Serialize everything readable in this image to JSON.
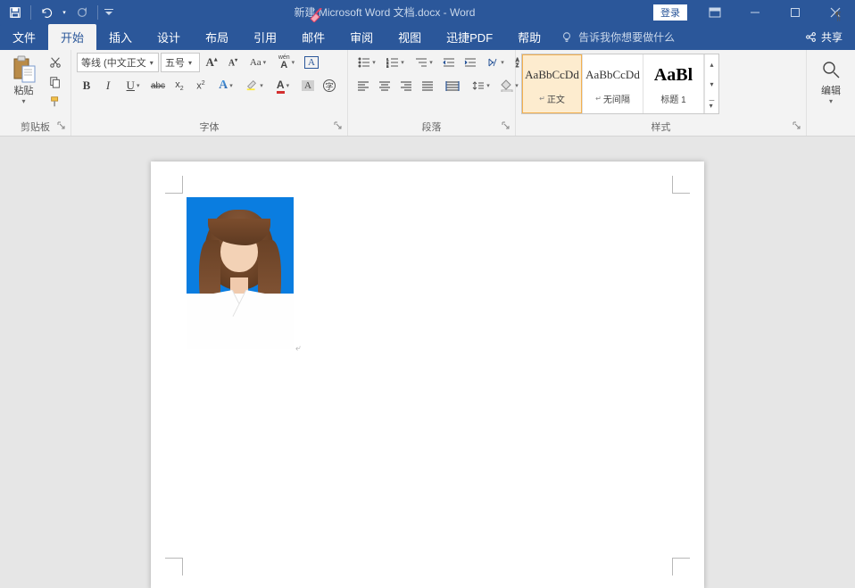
{
  "titlebar": {
    "doc_title": "新建 Microsoft Word 文档.docx  -  Word",
    "login": "登录"
  },
  "tabs": {
    "file": "文件",
    "home": "开始",
    "insert": "插入",
    "design": "设计",
    "layout": "布局",
    "references": "引用",
    "mailings": "邮件",
    "review": "审阅",
    "view": "视图",
    "pdf": "迅捷PDF",
    "help": "帮助",
    "tell_me": "告诉我你想要做什么",
    "share": "共享"
  },
  "ribbon": {
    "clipboard": {
      "paste": "粘贴",
      "group": "剪贴板"
    },
    "font": {
      "name": "等线 (中文正文",
      "size": "五号",
      "group": "字体"
    },
    "paragraph": {
      "group": "段落"
    },
    "styles": {
      "group": "样式",
      "items": [
        {
          "preview": "AaBbCcDd",
          "name": "正文",
          "selected": true
        },
        {
          "preview": "AaBbCcDd",
          "name": "无间隔",
          "selected": false
        },
        {
          "preview": "AaBl",
          "name": "标题 1",
          "selected": false
        }
      ]
    },
    "editing": {
      "label": "编辑"
    }
  },
  "icons": {
    "bold": "B",
    "italic": "I",
    "underline": "U",
    "strike": "abc",
    "sub": "x₂",
    "sup": "x²",
    "Aa": "Aa",
    "wen": "wén",
    "box_a": "A",
    "clear": "A",
    "larger": "A",
    "smaller": "A",
    "refresh": "⟳"
  }
}
